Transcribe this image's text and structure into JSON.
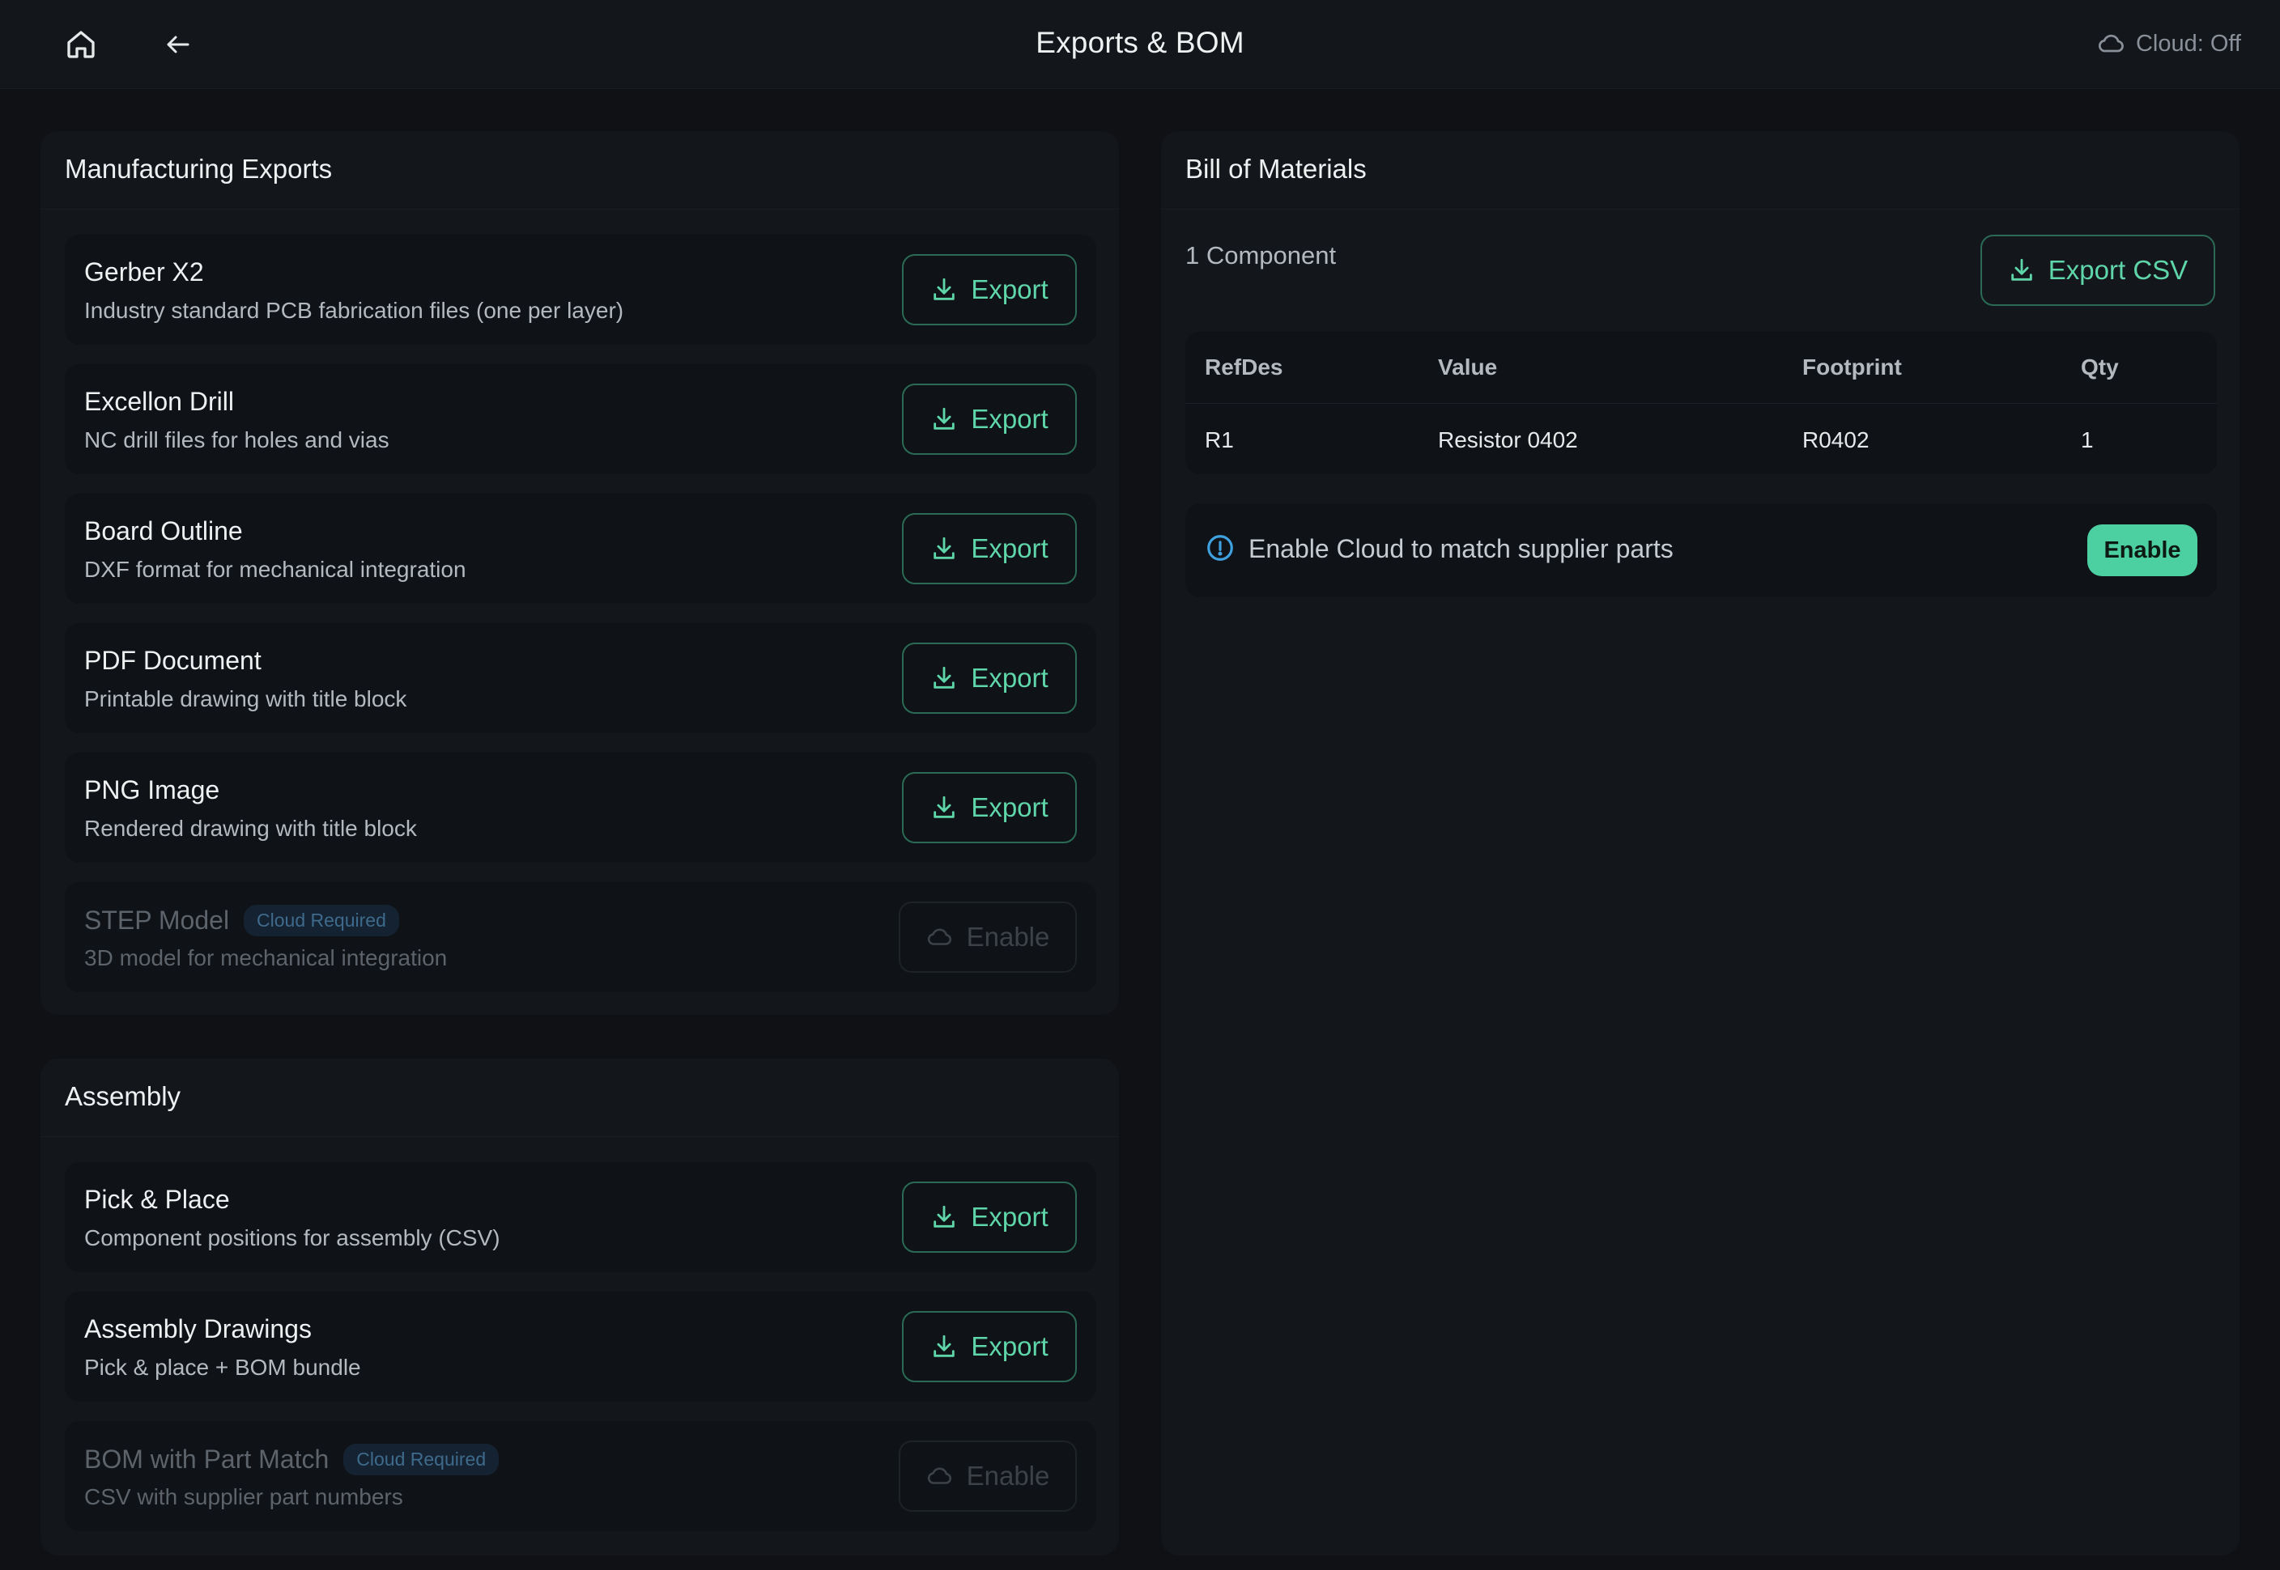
{
  "header": {
    "title": "Exports & BOM",
    "cloud_status": "Cloud: Off"
  },
  "manufacturing": {
    "title": "Manufacturing Exports",
    "items": [
      {
        "name": "Gerber X2",
        "desc": "Industry standard PCB fabrication files (one per layer)",
        "action": "Export"
      },
      {
        "name": "Excellon Drill",
        "desc": "NC drill files for holes and vias",
        "action": "Export"
      },
      {
        "name": "Board Outline",
        "desc": "DXF format for mechanical integration",
        "action": "Export"
      },
      {
        "name": "PDF Document",
        "desc": "Printable drawing with title block",
        "action": "Export"
      },
      {
        "name": "PNG Image",
        "desc": "Rendered drawing with title block",
        "action": "Export"
      },
      {
        "name": "STEP Model",
        "badge": "Cloud Required",
        "desc": "3D model for mechanical integration",
        "action": "Enable"
      }
    ]
  },
  "assembly": {
    "title": "Assembly",
    "items": [
      {
        "name": "Pick & Place",
        "desc": "Component positions for assembly (CSV)",
        "action": "Export"
      },
      {
        "name": "Assembly Drawings",
        "desc": "Pick & place + BOM bundle",
        "action": "Export"
      },
      {
        "name": "BOM with Part Match",
        "badge": "Cloud Required",
        "desc": "CSV with supplier part numbers",
        "action": "Enable"
      }
    ]
  },
  "bom": {
    "title": "Bill of Materials",
    "count": "1 Component",
    "export_label": "Export CSV",
    "columns": [
      "RefDes",
      "Value",
      "Footprint",
      "Qty"
    ],
    "rows": [
      [
        "R1",
        "Resistor 0402",
        "R0402",
        "1"
      ]
    ],
    "info_text": "Enable Cloud to match supplier parts",
    "enable_label": "Enable"
  },
  "colors": {
    "accent": "#4dd0a1",
    "background": "#0f1115",
    "panel": "#13161b"
  },
  "icons": [
    "home-icon",
    "back-arrow-icon",
    "cloud-icon",
    "download-icon",
    "info-icon"
  ]
}
